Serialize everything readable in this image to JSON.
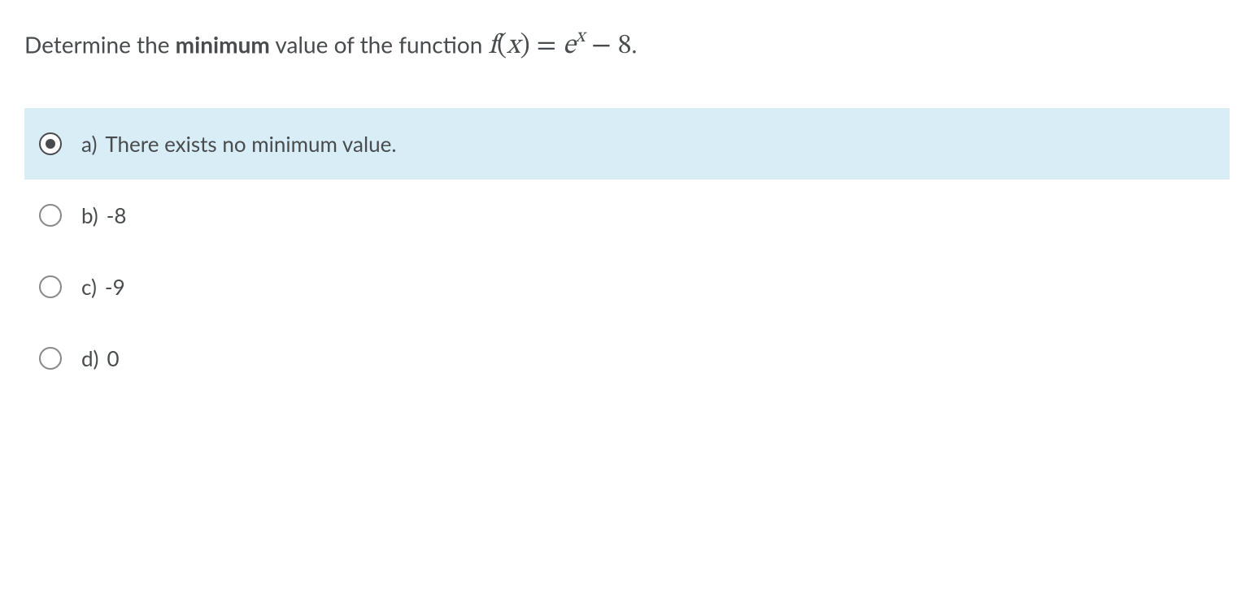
{
  "question": {
    "prefix": "Determine the ",
    "emphasis": "minimum",
    "middle": " value of the function ",
    "math_f": "f",
    "math_x": "x",
    "math_e": "e",
    "math_exp": "x",
    "math_const": "8",
    "suffix": "."
  },
  "options": [
    {
      "letter": "a)",
      "text": "There exists no minimum value.",
      "selected": true
    },
    {
      "letter": "b)",
      "text": "-8",
      "selected": false
    },
    {
      "letter": "c)",
      "text": "-9",
      "selected": false
    },
    {
      "letter": "d)",
      "text": "0",
      "selected": false
    }
  ]
}
